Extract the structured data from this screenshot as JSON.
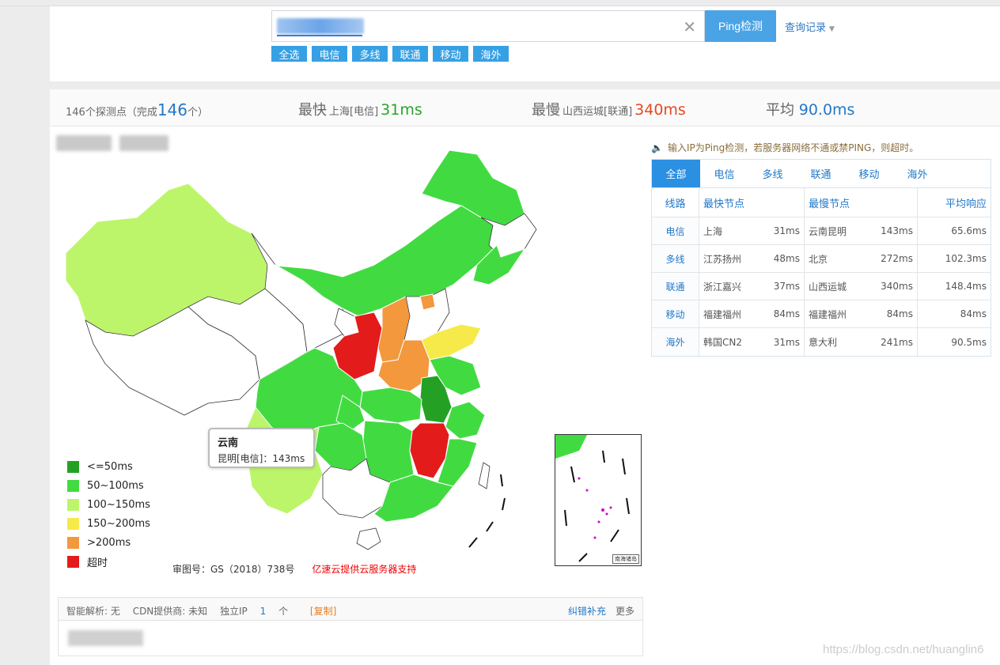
{
  "search": {
    "ping_label": "Ping检测",
    "history_label": "查询记录",
    "clear_symbol": "✕",
    "filters": [
      "全选",
      "电信",
      "多线",
      "联通",
      "移动",
      "海外"
    ]
  },
  "summary": {
    "count_prefix": "146个探测点（完成",
    "count_done": "146",
    "count_suffix": "个）",
    "fastest_label": "最快",
    "fastest_loc": "上海[电信]",
    "fastest_value": "31ms",
    "slowest_label": "最慢",
    "slowest_loc": "山西运城[联通]",
    "slowest_value": "340ms",
    "avg_label": "平均",
    "avg_value": "90.0ms"
  },
  "map": {
    "tooltip": {
      "title": "云南",
      "line": "昆明[电信]：143ms"
    },
    "legend": [
      {
        "label": "<=50ms",
        "color": "#24a124"
      },
      {
        "label": "50~100ms",
        "color": "#41db41"
      },
      {
        "label": "100~150ms",
        "color": "#bdf56a"
      },
      {
        "label": "150~200ms",
        "color": "#f5ea4a"
      },
      {
        "label": ">200ms",
        "color": "#f3983c"
      },
      {
        "label": "超时",
        "color": "#e31b1b"
      }
    ],
    "approval": "审图号：GS（2018）738号",
    "sponsor": "亿速云提供云服务器支持",
    "inset_label": "南海诸岛"
  },
  "notice": {
    "speaker_icon": "🔈",
    "text": "输入IP为Ping检测，若服务器网络不通或禁PING，则超时。"
  },
  "table": {
    "tabs": [
      "全部",
      "电信",
      "多线",
      "联通",
      "移动",
      "海外"
    ],
    "headers": [
      "线路",
      "最快节点",
      "最慢节点",
      "平均响应"
    ],
    "rows": [
      {
        "line": "电信",
        "fast": "上海",
        "fast_ms": "31ms",
        "slow": "云南昆明",
        "slow_ms": "143ms",
        "avg": "65.6ms"
      },
      {
        "line": "多线",
        "fast": "江苏扬州",
        "fast_ms": "48ms",
        "slow": "北京",
        "slow_ms": "272ms",
        "avg": "102.3ms"
      },
      {
        "line": "联通",
        "fast": "浙江嘉兴",
        "fast_ms": "37ms",
        "slow": "山西运城",
        "slow_ms": "340ms",
        "avg": "148.4ms"
      },
      {
        "line": "移动",
        "fast": "福建福州",
        "fast_ms": "84ms",
        "slow": "福建福州",
        "slow_ms": "84ms",
        "avg": "84ms"
      },
      {
        "line": "海外",
        "fast": "韩国CN2",
        "fast_ms": "31ms",
        "slow": "意大利",
        "slow_ms": "241ms",
        "avg": "90.5ms"
      }
    ]
  },
  "dns": {
    "smart": "智能解析: 无",
    "cdn": "CDN提供商: 未知",
    "ip_label": "独立IP",
    "ip_count": "1",
    "ip_unit": "个",
    "copy": "[复制]",
    "fix": "纠错补充",
    "more": "更多"
  },
  "watermark": "https://blog.csdn.net/huanglin6"
}
